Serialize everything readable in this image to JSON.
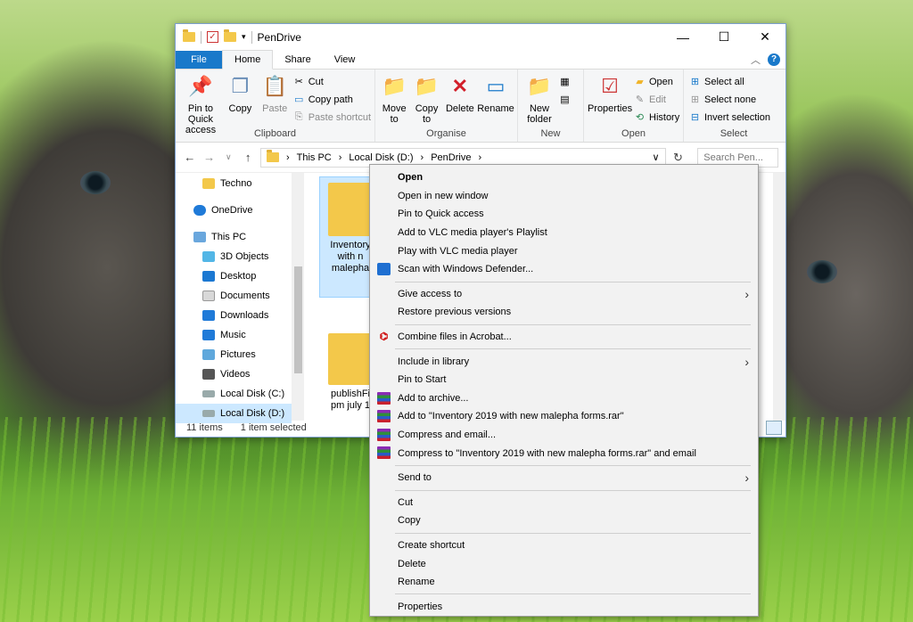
{
  "window": {
    "title": "PenDrive",
    "controls": [
      "—",
      "☐",
      "✕"
    ]
  },
  "tabs": [
    "File",
    "Home",
    "Share",
    "View"
  ],
  "ribbon": {
    "clipboard": {
      "label": "Clipboard",
      "pin": "Pin to Quick access",
      "copy": "Copy",
      "paste": "Paste",
      "cut": "Cut",
      "copy_path": "Copy path",
      "paste_shortcut": "Paste shortcut"
    },
    "organise": {
      "label": "Organise",
      "move_to": "Move to",
      "copy_to": "Copy to",
      "delete": "Delete",
      "rename": "Rename"
    },
    "new": {
      "label": "New",
      "new_folder": "New folder"
    },
    "open": {
      "label": "Open",
      "properties": "Properties",
      "open": "Open",
      "edit": "Edit",
      "history": "History"
    },
    "select": {
      "label": "Select",
      "select_all": "Select all",
      "select_none": "Select none",
      "invert": "Invert selection"
    }
  },
  "address": {
    "crumbs": [
      "This PC",
      "Local Disk (D:)",
      "PenDrive"
    ],
    "search_placeholder": "Search Pen..."
  },
  "nav": {
    "items": [
      {
        "label": "Techno"
      },
      {
        "label": "OneDrive"
      },
      {
        "label": "This PC"
      },
      {
        "label": "3D Objects"
      },
      {
        "label": "Desktop"
      },
      {
        "label": "Documents"
      },
      {
        "label": "Downloads"
      },
      {
        "label": "Music"
      },
      {
        "label": "Pictures"
      },
      {
        "label": "Videos"
      },
      {
        "label": "Local Disk (C:)"
      },
      {
        "label": "Local Disk (D:)"
      }
    ]
  },
  "files": [
    {
      "line1": "Inventory",
      "line2": "with n",
      "line3": "malepha"
    },
    {
      "line1": "publishFi",
      "line2": "pm july 1",
      "line3": ""
    }
  ],
  "status": {
    "items": "11 items",
    "selected": "1 item selected"
  },
  "context_menu": {
    "items": [
      {
        "label": "Open",
        "bold": true
      },
      {
        "label": "Open in new window"
      },
      {
        "label": "Pin to Quick access"
      },
      {
        "label": "Add to VLC media player's Playlist"
      },
      {
        "label": "Play with VLC media player"
      },
      {
        "label": "Scan with Windows Defender..."
      },
      {
        "label": "Give access to"
      },
      {
        "label": "Restore previous versions"
      },
      {
        "label": "Combine files in Acrobat..."
      },
      {
        "label": "Include in library"
      },
      {
        "label": "Pin to Start"
      },
      {
        "label": "Add to archive..."
      },
      {
        "label": "Add to \"Inventory 2019 with new malepha forms.rar\""
      },
      {
        "label": "Compress and email..."
      },
      {
        "label": "Compress to \"Inventory 2019 with new malepha forms.rar\" and email"
      },
      {
        "label": "Send to"
      },
      {
        "label": "Cut"
      },
      {
        "label": "Copy"
      },
      {
        "label": "Create shortcut"
      },
      {
        "label": "Delete"
      },
      {
        "label": "Rename"
      },
      {
        "label": "Properties"
      }
    ]
  },
  "colors": {
    "accent": "#1979ca",
    "selection": "#cce8ff",
    "menu_bg": "#f2f2f2"
  }
}
